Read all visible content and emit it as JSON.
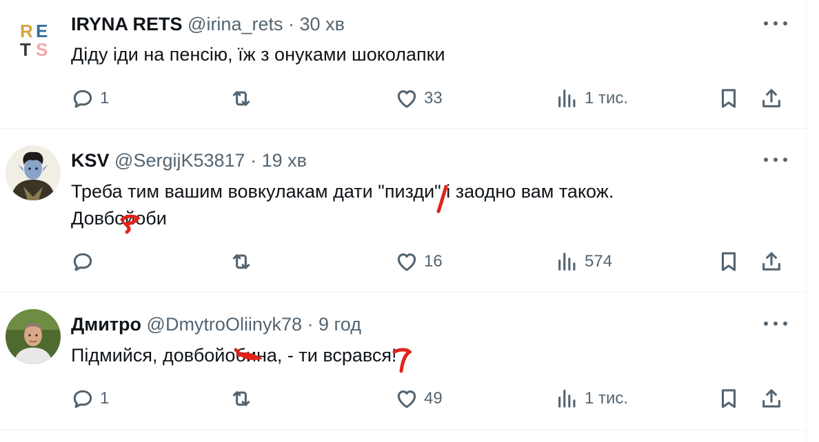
{
  "posts": [
    {
      "name": "IRYNA RETS",
      "handle": "@irina_rets",
      "separator": "·",
      "time": "30 хв",
      "text": "Діду іди на пенсію, їж з онуками шоколапки",
      "replies": "1",
      "reposts": "",
      "likes": "33",
      "views": "1 тис.",
      "avatar": {
        "type": "rets-logo",
        "letters": [
          "R",
          "E",
          "T",
          "S"
        ]
      }
    },
    {
      "name": "KSV",
      "handle": "@SergijK53817",
      "separator": "·",
      "time": "19 хв",
      "text_line1": "Треба тим вашим вовкулакам дати \"пизди\" і заодно вам також.",
      "text_line2": "Довбойоби",
      "replies": "",
      "reposts": "",
      "likes": "16",
      "views": "574",
      "avatar": {
        "type": "fantasy-portrait"
      }
    },
    {
      "name": "Дмитро",
      "handle": "@DmytroOliinyk78",
      "separator": "·",
      "time": "9 год",
      "text": "Підмийся, довбойобина, - ти всрався!",
      "replies": "1",
      "reposts": "",
      "likes": "49",
      "views": "1 тис.",
      "avatar": {
        "type": "photo-portrait"
      }
    }
  ],
  "icons": {
    "reply": "reply-icon",
    "repost": "repost-icon",
    "like": "like-icon",
    "views": "views-icon",
    "bookmark": "bookmark-icon",
    "share": "share-icon",
    "more": "more-icon"
  },
  "colors": {
    "text": "#0f1419",
    "secondary": "#536471",
    "border": "#eff3f4",
    "censor_mark": "#e0241b",
    "rets_r": "#d9a441",
    "rets_e": "#2f6f9f",
    "rets_t": "#3b3b3b",
    "rets_s": "#f2a7a7"
  }
}
